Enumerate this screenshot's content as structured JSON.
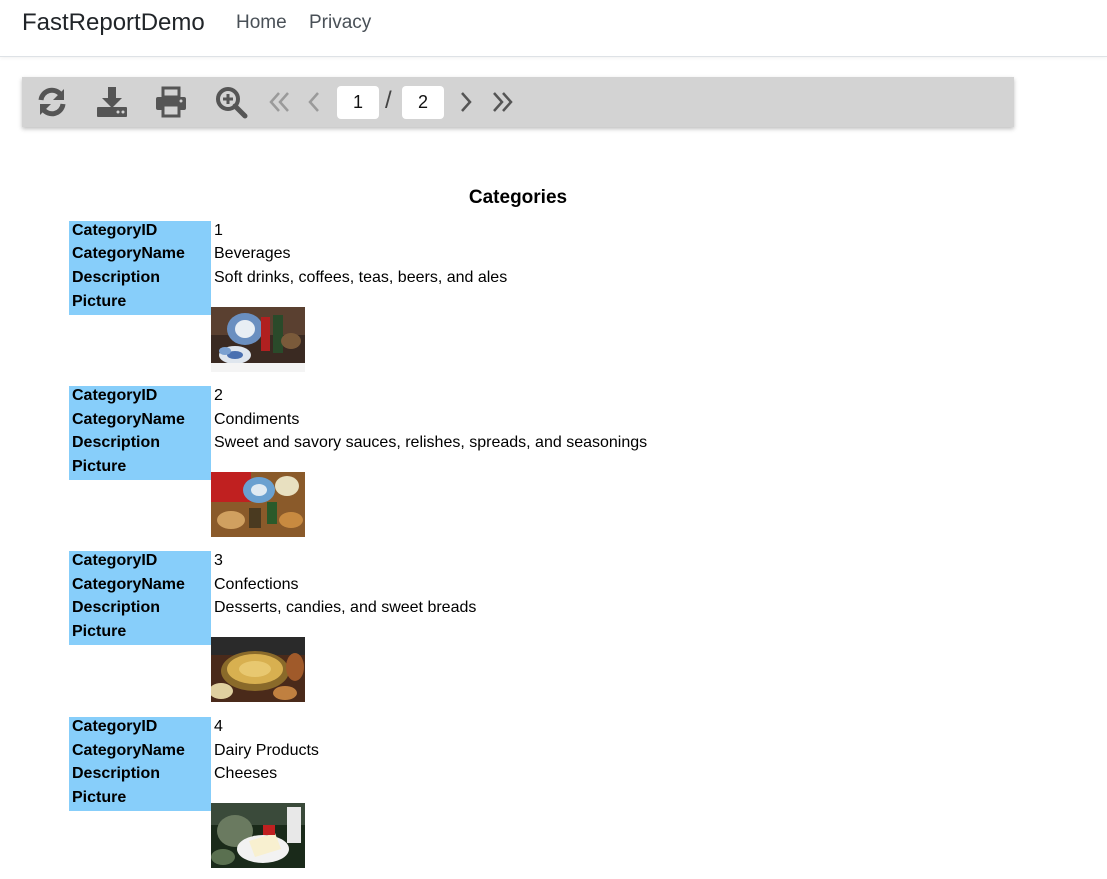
{
  "navbar": {
    "brand": "FastReportDemo",
    "links": [
      {
        "label": "Home"
      },
      {
        "label": "Privacy"
      }
    ]
  },
  "toolbar": {
    "buttons": [
      "refresh-icon",
      "download-icon",
      "print-icon",
      "zoom-in-icon",
      "first-page-icon",
      "previous-page-icon",
      "next-page-icon",
      "last-page-icon"
    ],
    "current_page": "1",
    "separator": "/",
    "total_pages": "2"
  },
  "report": {
    "title": "Categories",
    "field_labels": {
      "id": "CategoryID",
      "name": "CategoryName",
      "description": "Description",
      "picture": "Picture"
    },
    "records": [
      {
        "id": "1",
        "name": "Beverages",
        "description": "Soft drinks, coffees, teas, beers, and ales",
        "picture": "beverages-photo"
      },
      {
        "id": "2",
        "name": "Condiments",
        "description": "Sweet and savory sauces, relishes, spreads, and seasonings",
        "picture": "condiments-photo"
      },
      {
        "id": "3",
        "name": "Confections",
        "description": "Desserts, candies, and sweet breads",
        "picture": "confections-photo"
      },
      {
        "id": "4",
        "name": "Dairy Products",
        "description": "Cheeses",
        "picture": "dairy-products-photo"
      }
    ]
  },
  "colors": {
    "label_background": "#87cefa",
    "toolbar_background": "#d3d3d3",
    "toolbar_icon": "#555555",
    "toolbar_icon_disabled": "#9a9a9a"
  }
}
